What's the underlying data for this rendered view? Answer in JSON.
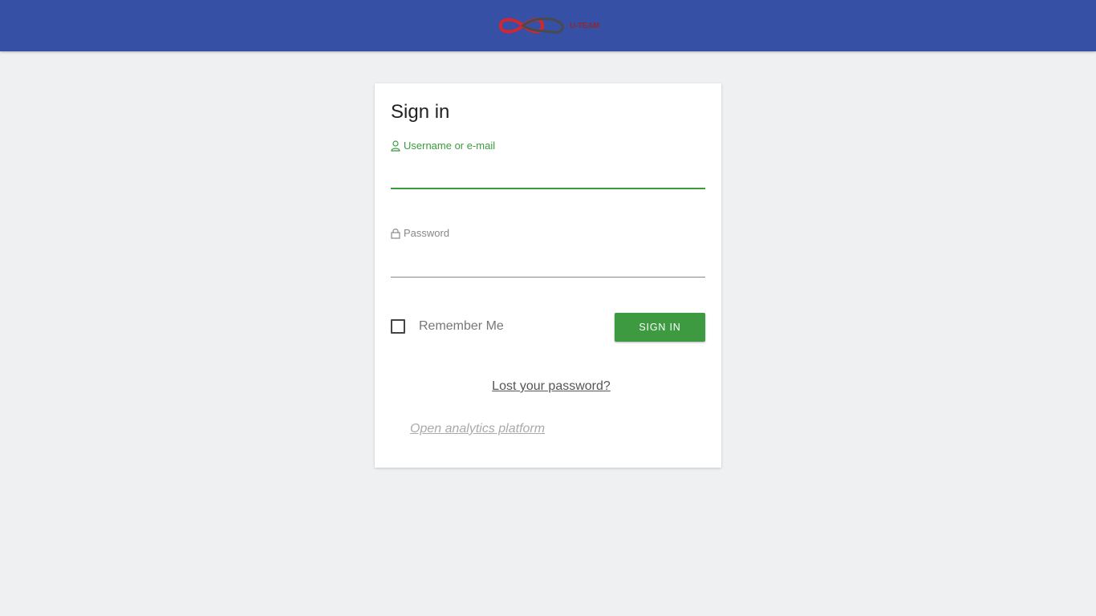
{
  "header": {
    "logo_text": "U-TEAM",
    "background_color": "#3550a5"
  },
  "login": {
    "title": "Sign in",
    "username": {
      "label": "Username or e-mail",
      "value": "",
      "icon": "user-icon"
    },
    "password": {
      "label": "Password",
      "value": "",
      "icon": "lock-icon"
    },
    "remember_label": "Remember Me",
    "remember_checked": false,
    "signin_label": "SIGN IN",
    "lost_password_label": "Lost your password?",
    "analytics_label": "Open analytics platform"
  },
  "colors": {
    "accent_green": "#3d9a40",
    "page_background": "#eff0f2"
  }
}
